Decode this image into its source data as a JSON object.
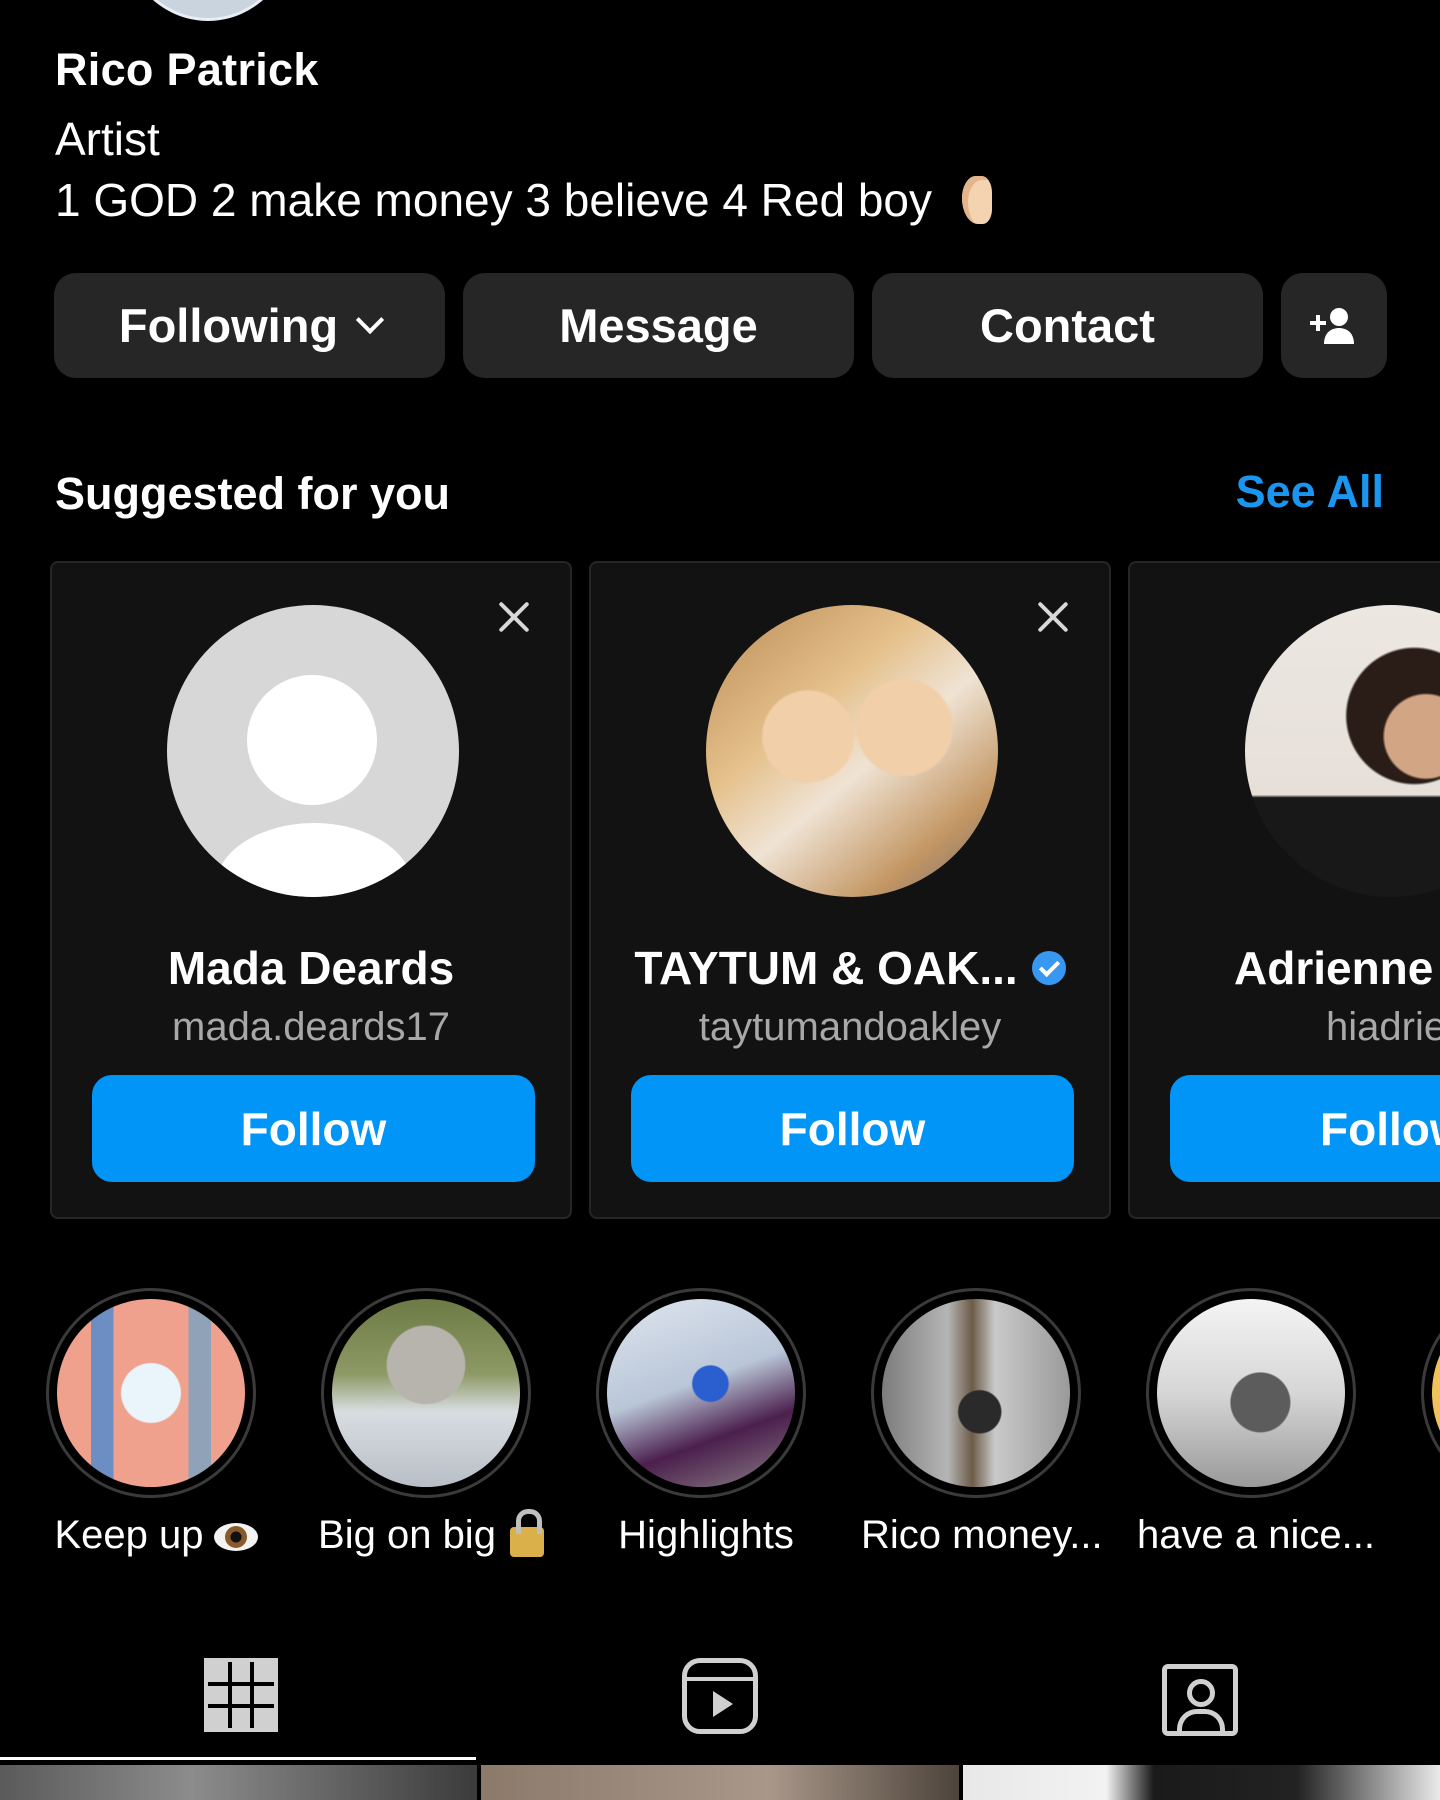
{
  "profile": {
    "name": "Rico Patrick",
    "category": "Artist",
    "bio": "1 GOD 2 make money 3 believe 4 Red boy",
    "bio_emoji": "ear-emoji"
  },
  "actions": {
    "following_label": "Following",
    "message_label": "Message",
    "contact_label": "Contact",
    "add_user_icon": "person-add-icon"
  },
  "suggested": {
    "title": "Suggested for you",
    "see_all_label": "See All",
    "cards": [
      {
        "name": "Mada Deards",
        "username": "mada.deards17",
        "follow_label": "Follow",
        "verified": false
      },
      {
        "name": "TAYTUM & OAK...",
        "username": "taytumandoakley",
        "follow_label": "Follow",
        "verified": true
      },
      {
        "name": "Adrienne",
        "username": "hiadrie",
        "follow_label": "Follow",
        "verified": false
      }
    ]
  },
  "highlights": [
    {
      "label": "Keep up",
      "emoji": "eye-emoji"
    },
    {
      "label": "Big on big",
      "emoji": "lock-emoji"
    },
    {
      "label": "Highlights"
    },
    {
      "label": "Rico money..."
    },
    {
      "label": "have a nice..."
    }
  ],
  "tabs": {
    "items": [
      "grid-icon",
      "reels-icon",
      "tagged-icon"
    ],
    "active": "grid-icon"
  },
  "colors": {
    "background": "#000000",
    "button_gray": "#262626",
    "accent_blue": "#0095f6",
    "link_blue": "#1a96f0",
    "verified_blue": "#3897f0"
  }
}
